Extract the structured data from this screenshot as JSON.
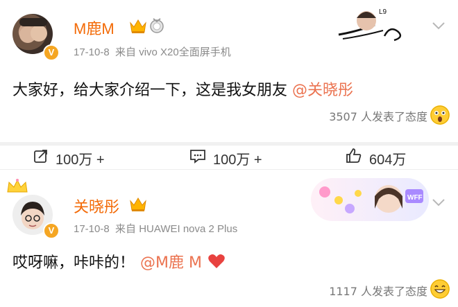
{
  "post1": {
    "author": "M鹿M",
    "time": "17-10-8",
    "source": "来自 vivo X20全面屏手机",
    "text_before": "大家好，给大家介绍一下，这是我女朋友",
    "mention": "@关晓彤",
    "reactions": "3507 人发表了态度",
    "verified_badge": "V"
  },
  "actions": {
    "repost": "100万 +",
    "comment": "100万 +",
    "like": "604万"
  },
  "post2": {
    "author": "关晓彤",
    "time": "17-10-8",
    "source": "来自 HUAWEI nova 2 Plus",
    "text_before": "哎呀嘛，咔咔的！",
    "mention": "@M鹿 M",
    "reactions": "1117 人发表了态度",
    "verified_badge": "V"
  },
  "colors": {
    "accent": "#f36b08",
    "mention": "#eb7350",
    "heart": "#e8423f"
  },
  "icons": [
    "crown-icon",
    "medal-icon",
    "chevron-down-icon",
    "repost-icon",
    "comment-icon",
    "like-icon",
    "heart-icon",
    "surprised-emoji-icon",
    "grin-emoji-icon"
  ]
}
